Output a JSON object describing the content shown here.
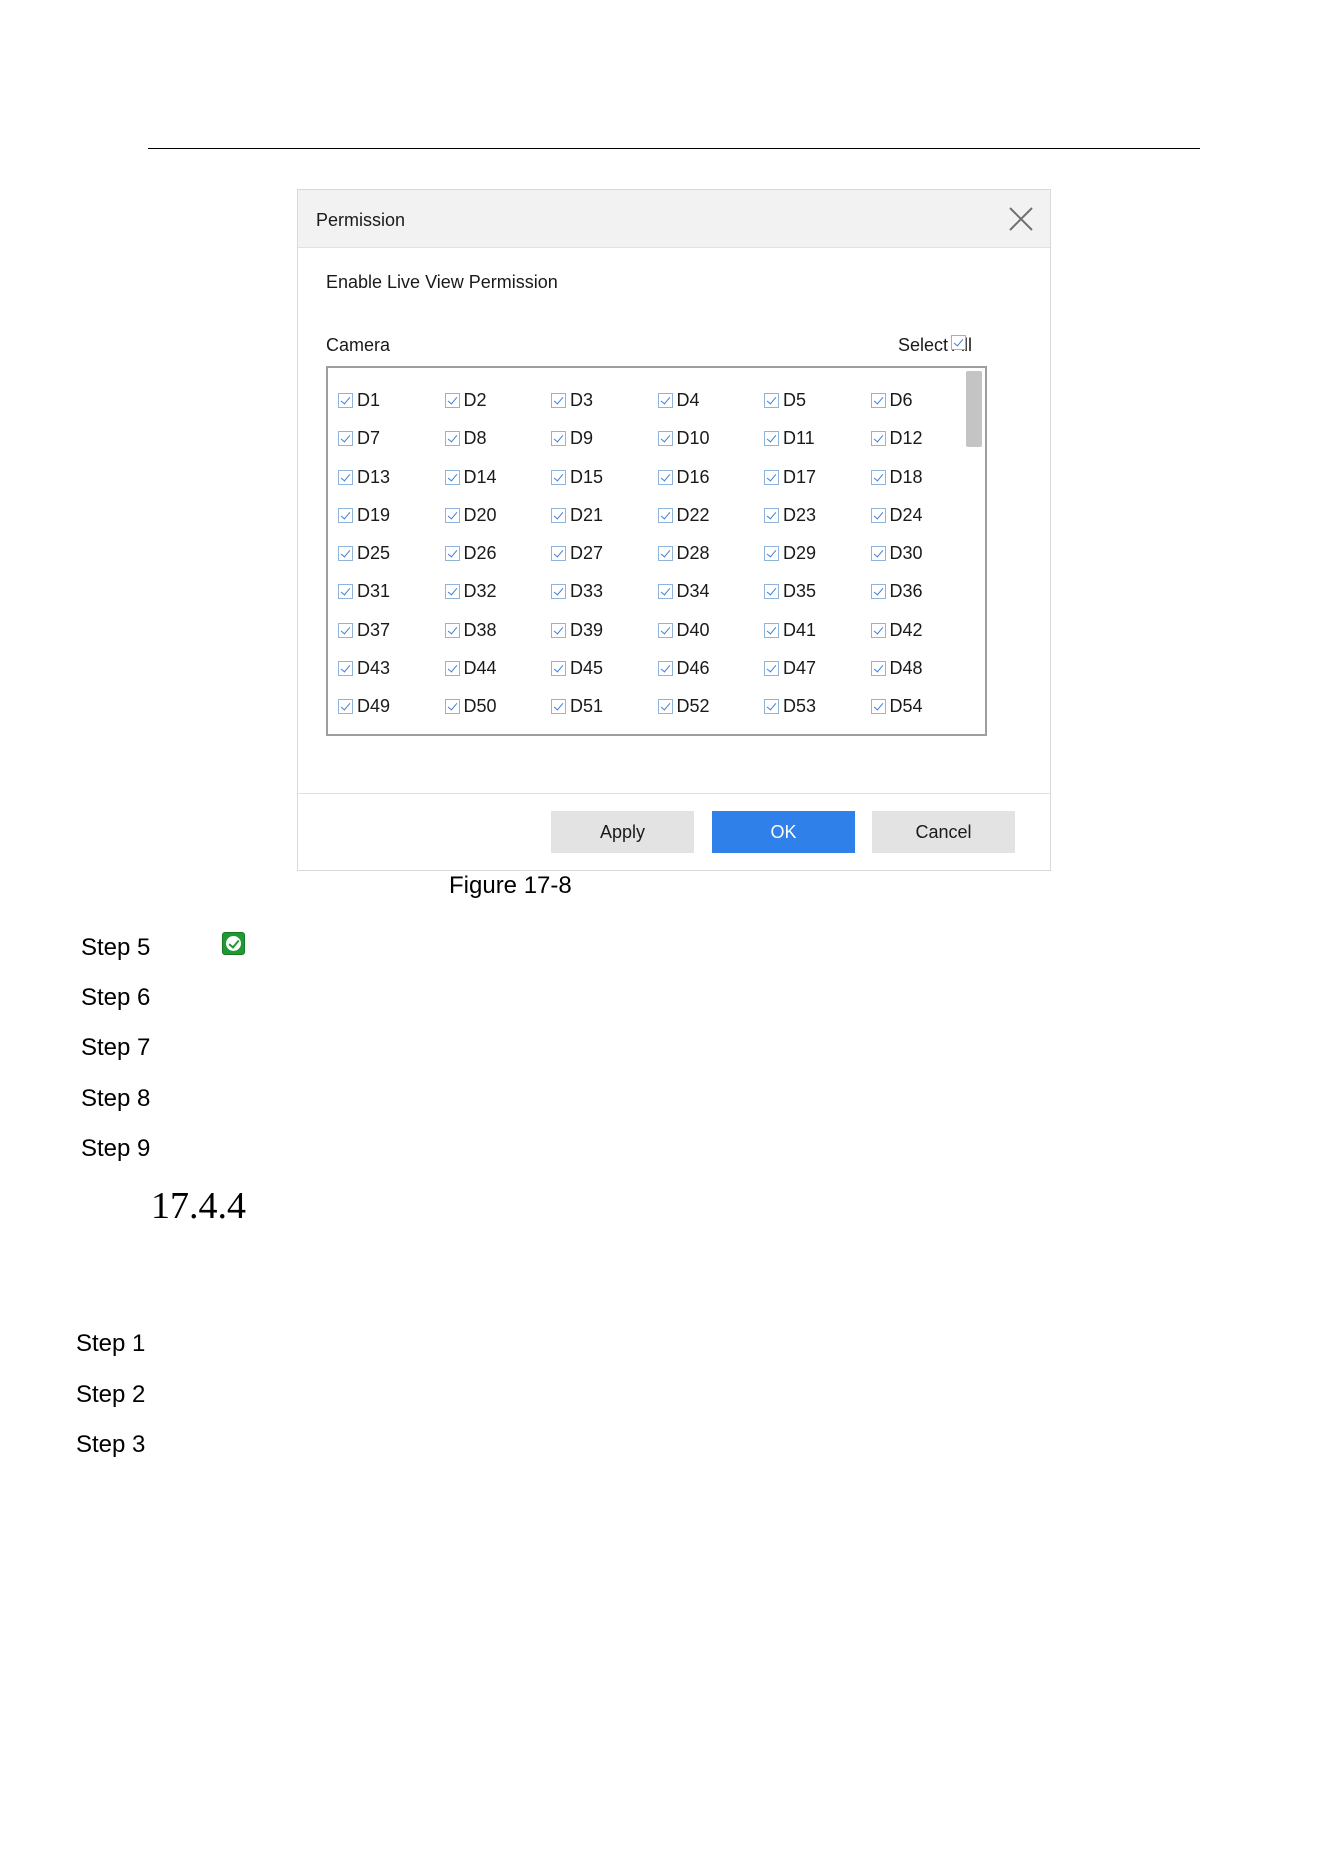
{
  "dialog": {
    "title": "Permission",
    "section_title": "Enable Live View Permission",
    "camera_label": "Camera",
    "select_all_label": "Select All",
    "select_all_checked": true,
    "cameras": [
      "D1",
      "D2",
      "D3",
      "D4",
      "D5",
      "D6",
      "D7",
      "D8",
      "D9",
      "D10",
      "D11",
      "D12",
      "D13",
      "D14",
      "D15",
      "D16",
      "D17",
      "D18",
      "D19",
      "D20",
      "D21",
      "D22",
      "D23",
      "D24",
      "D25",
      "D26",
      "D27",
      "D28",
      "D29",
      "D30",
      "D31",
      "D32",
      "D33",
      "D34",
      "D35",
      "D36",
      "D37",
      "D38",
      "D39",
      "D40",
      "D41",
      "D42",
      "D43",
      "D44",
      "D45",
      "D46",
      "D47",
      "D48",
      "D49",
      "D50",
      "D51",
      "D52",
      "D53",
      "D54"
    ],
    "buttons": {
      "apply": "Apply",
      "ok": "OK",
      "cancel": "Cancel"
    }
  },
  "caption": "Figure 17-8",
  "steps_a": [
    "Step 5",
    "Step 6",
    "Step 7",
    "Step 8",
    "Step 9"
  ],
  "section_number": "17.4.4",
  "steps_b": [
    "Step 1",
    "Step 2",
    "Step 3"
  ],
  "colors": {
    "primary_button": "#2f80e8",
    "check": "#3d7fd6",
    "ok_icon": "#1f9a32"
  }
}
